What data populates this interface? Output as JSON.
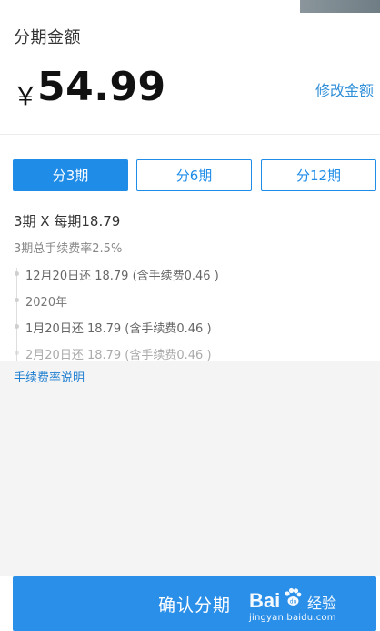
{
  "header": {
    "title": "分期金额"
  },
  "amount": {
    "currency": "￥",
    "value": "54.99",
    "edit_label": "修改金额"
  },
  "tabs": [
    {
      "label": "分3期",
      "active": true
    },
    {
      "label": "分6期",
      "active": false
    },
    {
      "label": "分12期",
      "active": false
    }
  ],
  "plan": {
    "summary": "3期 X 每期18.79",
    "fee_rate": "3期总手续费率2.5%"
  },
  "schedule": [
    {
      "text": "12月20日还 18.79 (含手续费0.46 )"
    },
    {
      "text": "2020年"
    },
    {
      "text": "1月20日还   18.79 (含手续费0.46 )"
    },
    {
      "text": "2月20日还   18.79 (含手续费0.46 )"
    }
  ],
  "fee_explain_label": "手续费率说明",
  "confirm_label": "确认分期",
  "watermark": {
    "brand": "Bai",
    "brand_suffix": "经验",
    "url": "jingyan.baidu.com"
  },
  "colors": {
    "accent": "#1f8ce8",
    "link": "#2f8fd8"
  }
}
